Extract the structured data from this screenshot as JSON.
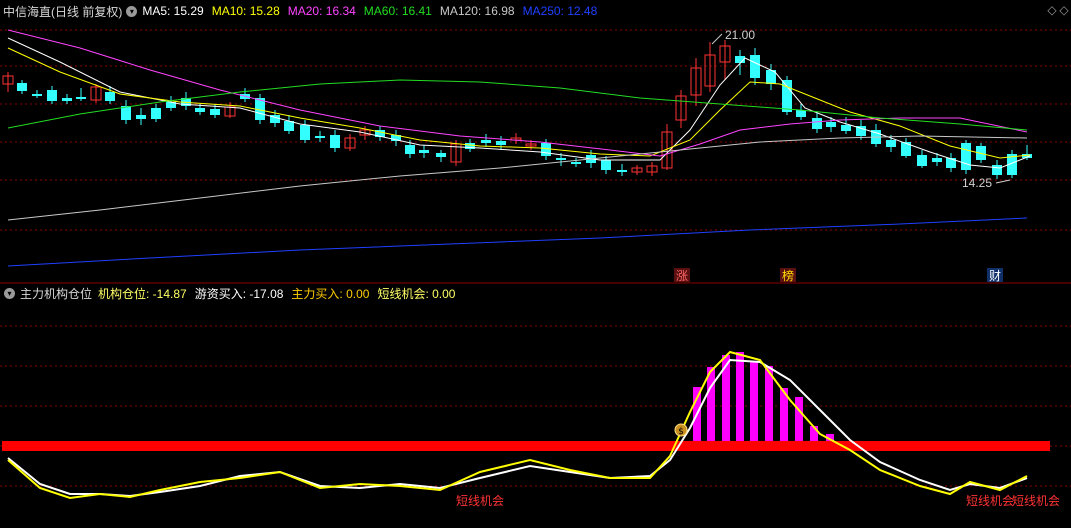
{
  "main_panel": {
    "title": "中信海直(日线 前复权)",
    "ma_items": [
      {
        "label": "MA5: 15.29",
        "color": "#ffffff"
      },
      {
        "label": "MA10: 15.28",
        "color": "#ffff00"
      },
      {
        "label": "MA20: 16.34",
        "color": "#ff44ff"
      },
      {
        "label": "MA60: 16.41",
        "color": "#22dd22"
      },
      {
        "label": "MA120: 16.98",
        "color": "#c8c8c8"
      },
      {
        "label": "MA250: 12.48",
        "color": "#2040ff"
      }
    ],
    "high_marker": "21.00",
    "low_marker": "14.25",
    "event_tags": [
      "涨",
      "榜",
      "财"
    ]
  },
  "indicator_panel": {
    "title": "主力机构仓位",
    "values": [
      {
        "label": "机构仓位: -14.87",
        "color": "#ffff66"
      },
      {
        "label": "游资买入: -17.08",
        "color": "#ffffff"
      },
      {
        "label": "主力买入: 0.00",
        "color": "#ffcc00"
      },
      {
        "label": "短线机会: 0.00",
        "color": "#ffff66"
      }
    ],
    "signal_labels": [
      "短线机会",
      "短线机会",
      "短线机会"
    ],
    "marker_glyph": "$"
  },
  "colors": {
    "background": "#000000",
    "up": "#ff3333",
    "down": "#33ffff",
    "grid": "#8a0000",
    "baseline": "#ff0000",
    "bars": "#ff00ff"
  },
  "icons": {
    "control": "settings-circle-icon",
    "left": "diamond-left-icon",
    "right": "diamond-right-icon"
  }
}
